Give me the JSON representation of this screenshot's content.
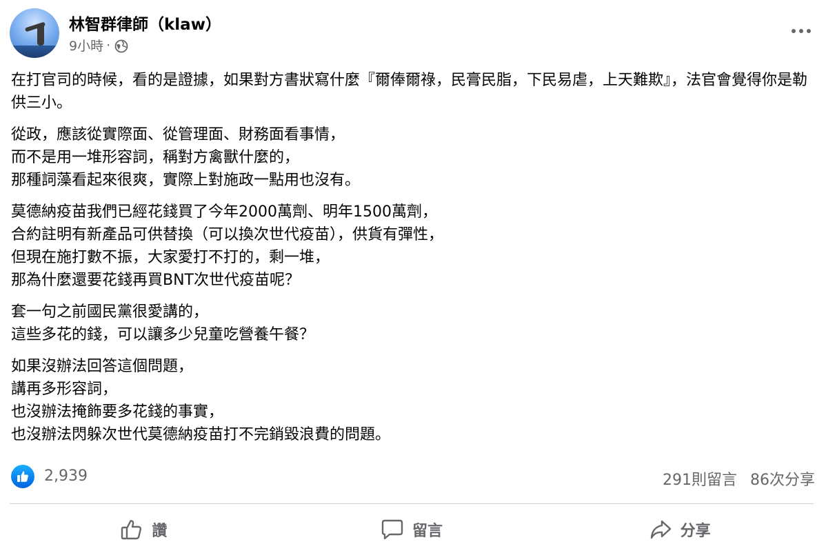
{
  "post": {
    "author": "林智群律師（klaw）",
    "time": "9小時",
    "separator": "·",
    "privacy_icon": "globe-icon",
    "more_icon": "more-dots-icon",
    "paragraphs": [
      "在打官司的時候，看的是證據，如果對方書狀寫什麼『爾俸爾祿，民膏民脂，下民易虐，上天難欺』，法官會覺得你是勒供三小。",
      "從政，應該從實際面、從管理面、財務面看事情，\n而不是用一堆形容詞，稱對方禽獸什麼的，\n那種詞藻看起來很爽，實際上對施政一點用也沒有。",
      "莫德納疫苗我們已經花錢買了今年2000萬劑、明年1500萬劑，\n合約註明有新產品可供替換（可以換次世代疫苗），供貨有彈性，\n但現在施打數不振，大家愛打不打的，剩一堆，\n那為什麼還要花錢再買BNT次世代疫苗呢？",
      "套一句之前國民黨很愛講的，\n這些多花的錢，可以讓多少兒童吃營養午餐？",
      "如果沒辦法回答這個問題，\n講再多形容詞，\n也沒辦法掩飾要多花錢的事實，\n也沒辦法閃躲次世代莫德納疫苗打不完銷毀浪費的問題。"
    ]
  },
  "stats": {
    "reaction_icon": "like-reaction-icon",
    "like_count": "2,939",
    "comments": "291則留言",
    "shares": "86次分享"
  },
  "actions": {
    "like_label": "讚",
    "comment_label": "留言",
    "share_label": "分享"
  },
  "colors": {
    "text": "#050505",
    "secondary": "#65676b",
    "like_blue": "#0866ff",
    "divider": "#ced0d4"
  }
}
